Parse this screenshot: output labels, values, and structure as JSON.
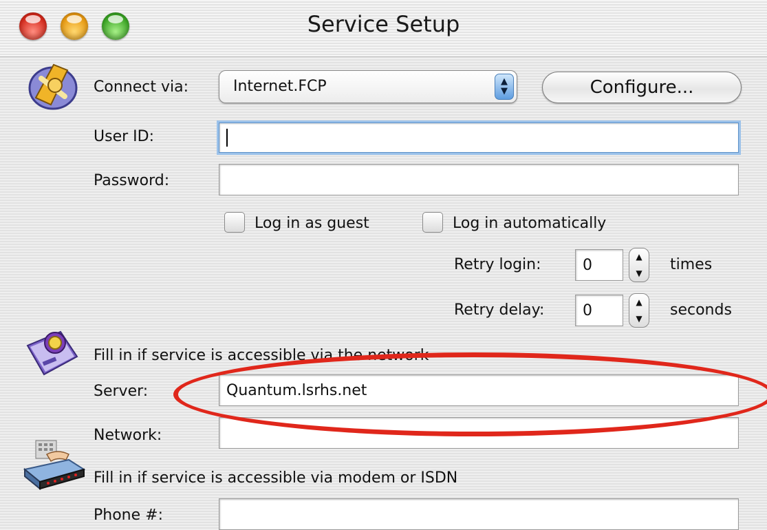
{
  "window": {
    "title": "Service Setup"
  },
  "connection": {
    "connect_via_label": "Connect via:",
    "connect_via_value": "Internet.FCP",
    "configure_label": "Configure...",
    "user_id_label": "User ID:",
    "user_id_value": "",
    "password_label": "Password:",
    "password_value": "",
    "guest_label": "Log in as guest",
    "auto_label": "Log in automatically",
    "retry_login_label": "Retry login:",
    "retry_login_value": "0",
    "retry_login_unit": "times",
    "retry_delay_label": "Retry delay:",
    "retry_delay_value": "0",
    "retry_delay_unit": "seconds"
  },
  "network": {
    "heading": "Fill in if service is accessible via the network",
    "server_label": "Server:",
    "server_value": "Quantum.lsrhs.net",
    "network_label": "Network:",
    "network_value": ""
  },
  "modem": {
    "heading": "Fill in if service is accessible via modem or ISDN",
    "phone_label": "Phone #:",
    "phone_value": ""
  },
  "colors": {
    "annotation_circle": "#e0271b",
    "focus_ring": "#9cc2ea",
    "popup_arrow": "#5e9de0"
  },
  "icons": [
    "close-light-icon",
    "minimize-light-icon",
    "zoom-light-icon",
    "connection-icon",
    "network-icon",
    "modem-icon",
    "up-arrow-icon",
    "down-arrow-icon"
  ]
}
